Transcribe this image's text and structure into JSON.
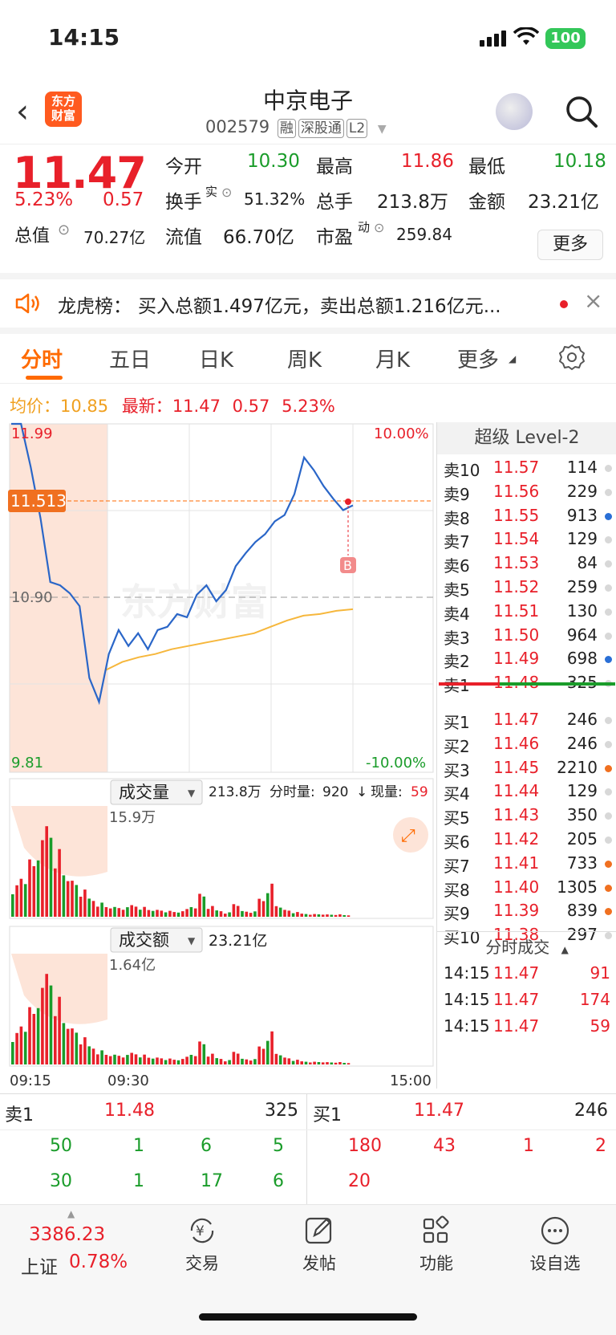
{
  "status": {
    "time": "14:15",
    "battery": "100"
  },
  "nav": {
    "title": "中京电子",
    "code": "002579",
    "tags": [
      "融",
      "深股通",
      "L2"
    ],
    "logo_line1": "东方",
    "logo_line2": "财富"
  },
  "quote": {
    "price": "11.47",
    "change_pct": "5.23%",
    "change": "0.57",
    "open_label": "今开",
    "open": "10.30",
    "high_label": "最高",
    "high": "11.86",
    "low_label": "最低",
    "low": "10.18",
    "turnover_label": "换手",
    "turnover_sup": "实",
    "turnover": "51.32%",
    "volume_label": "总手",
    "volume": "213.8万",
    "amount_label": "金额",
    "amount": "23.21亿",
    "mktcap_label": "总值",
    "mktcap": "70.27亿",
    "float_label": "流值",
    "float": "66.70亿",
    "pe_label": "市盈",
    "pe_sup": "动",
    "pe": "259.84",
    "more": "更多"
  },
  "news": {
    "label": "龙虎榜：",
    "text": "买入总额1.497亿元，卖出总额1.216亿元..."
  },
  "tabs": [
    "分时",
    "五日",
    "日K",
    "周K",
    "月K",
    "更多"
  ],
  "chart_info": {
    "avg_label": "均价：",
    "avg": "10.85",
    "latest_label": "最新：",
    "latest": "11.47",
    "chg": "0.57",
    "chg_pct": "5.23%"
  },
  "chart_data": {
    "type": "line",
    "y_top": "11.99",
    "y_mid": "10.90",
    "y_bottom": "9.81",
    "pct_top": "10.00%",
    "pct_bottom": "-10.00%",
    "cursor_price": "11.513",
    "trade_marker": "B",
    "watermark": "东方财富",
    "ylim": [
      9.81,
      11.99
    ],
    "x_labels": [
      "09:15",
      "09:30",
      "15:00"
    ],
    "series": [
      {
        "values": [
          11.99,
          11.99,
          11.72,
          11.4,
          11.0,
          10.98,
          10.93,
          10.85,
          10.4,
          10.25,
          10.55,
          10.7,
          10.6,
          10.68,
          10.58,
          10.7,
          10.72,
          10.8,
          10.78,
          10.92,
          10.98,
          10.88,
          10.95,
          11.1,
          11.18,
          11.25,
          11.3,
          11.38,
          11.42,
          11.55,
          11.78,
          11.7,
          11.6,
          11.52,
          11.45,
          11.48
        ]
      },
      {
        "values": [
          10.45,
          10.5,
          10.53,
          10.55,
          10.58,
          10.6,
          10.62,
          10.64,
          10.66,
          10.68,
          10.72,
          10.76,
          10.79,
          10.8,
          10.82,
          10.83
        ]
      }
    ],
    "volume": {
      "label": "成交量",
      "total": "213.8万",
      "minute_label": "分时量:",
      "minute": "920",
      "arrow": "↓",
      "now_label": "现量:",
      "now": "59",
      "max": "15.9万"
    },
    "amount": {
      "label": "成交额",
      "total": "23.21亿",
      "max": "1.64亿"
    }
  },
  "level2": {
    "title": "超级 Level-2",
    "asks": [
      {
        "label": "卖10",
        "price": "11.57",
        "vol": "114",
        "dot": "#d8d8d8"
      },
      {
        "label": "卖9",
        "price": "11.56",
        "vol": "229",
        "dot": "#d8d8d8"
      },
      {
        "label": "卖8",
        "price": "11.55",
        "vol": "913",
        "dot": "#2a6fd6"
      },
      {
        "label": "卖7",
        "price": "11.54",
        "vol": "129",
        "dot": "#d8d8d8"
      },
      {
        "label": "卖6",
        "price": "11.53",
        "vol": "84",
        "dot": "#d8d8d8"
      },
      {
        "label": "卖5",
        "price": "11.52",
        "vol": "259",
        "dot": "#d8d8d8"
      },
      {
        "label": "卖4",
        "price": "11.51",
        "vol": "130",
        "dot": "#d8d8d8"
      },
      {
        "label": "卖3",
        "price": "11.50",
        "vol": "964",
        "dot": "#d8d8d8"
      },
      {
        "label": "卖2",
        "price": "11.49",
        "vol": "698",
        "dot": "#2a6fd6"
      },
      {
        "label": "卖1",
        "price": "11.48",
        "vol": "325",
        "dot": "#d8d8d8"
      }
    ],
    "bids": [
      {
        "label": "买1",
        "price": "11.47",
        "vol": "246",
        "dot": "#d8d8d8"
      },
      {
        "label": "买2",
        "price": "11.46",
        "vol": "246",
        "dot": "#d8d8d8"
      },
      {
        "label": "买3",
        "price": "11.45",
        "vol": "2210",
        "dot": "#f07020"
      },
      {
        "label": "买4",
        "price": "11.44",
        "vol": "129",
        "dot": "#d8d8d8"
      },
      {
        "label": "买5",
        "price": "11.43",
        "vol": "350",
        "dot": "#d8d8d8"
      },
      {
        "label": "买6",
        "price": "11.42",
        "vol": "205",
        "dot": "#d8d8d8"
      },
      {
        "label": "买7",
        "price": "11.41",
        "vol": "733",
        "dot": "#f07020"
      },
      {
        "label": "买8",
        "price": "11.40",
        "vol": "1305",
        "dot": "#f07020"
      },
      {
        "label": "买9",
        "price": "11.39",
        "vol": "839",
        "dot": "#f07020"
      },
      {
        "label": "买10",
        "price": "11.38",
        "vol": "297",
        "dot": "#d8d8d8"
      }
    ],
    "ticks_title": "分时成交",
    "ticks": [
      {
        "time": "14:15",
        "price": "11.47",
        "vol": "91"
      },
      {
        "time": "14:15",
        "price": "11.47",
        "vol": "174"
      },
      {
        "time": "14:15",
        "price": "11.47",
        "vol": "59"
      }
    ]
  },
  "bottom_book": {
    "sell_label": "卖1",
    "sell_price": "11.48",
    "sell_vol": "325",
    "buy_label": "买1",
    "buy_price": "11.47",
    "buy_vol": "246",
    "sell_queue": [
      [
        "50",
        "1",
        "6",
        "5"
      ],
      [
        "30",
        "1",
        "17",
        "6"
      ]
    ],
    "buy_queue": [
      [
        "180",
        "43",
        "1",
        "2"
      ],
      [
        "20"
      ]
    ]
  },
  "tabbar": {
    "index_value": "3386.23",
    "index_name": "上证",
    "index_pct": "0.78%",
    "items": [
      "交易",
      "发帖",
      "功能",
      "设自选"
    ]
  }
}
